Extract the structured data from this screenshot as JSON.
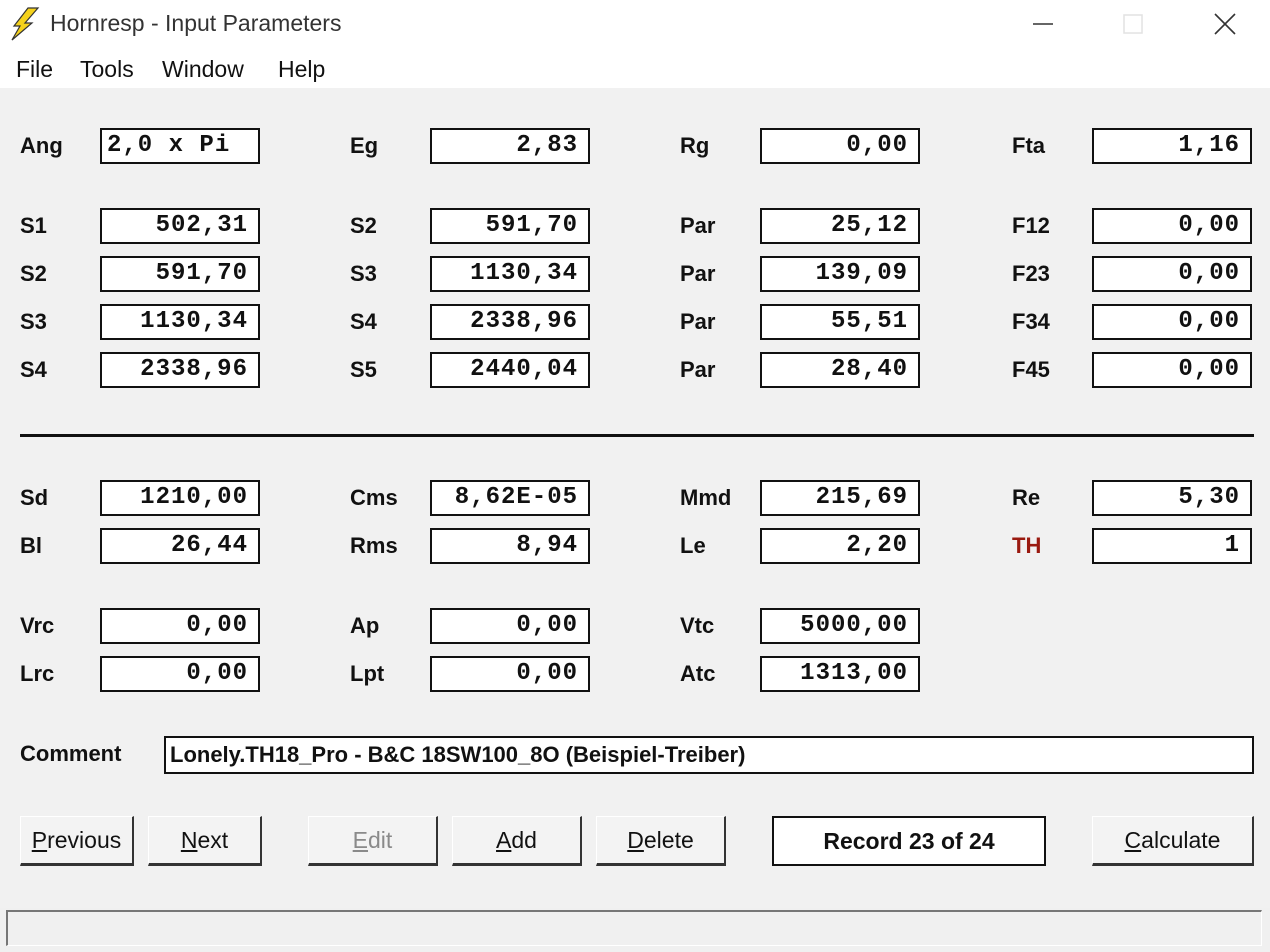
{
  "window": {
    "title": "Hornresp - Input Parameters",
    "icon": "lightning-bolt-icon"
  },
  "menu": [
    "File",
    "Tools",
    "Window",
    "Help"
  ],
  "rows": [
    [
      {
        "label": "Ang",
        "value": "2,0 x Pi",
        "align": "left"
      },
      {
        "label": "Eg",
        "value": "2,83"
      },
      {
        "label": "Rg",
        "value": "0,00"
      },
      {
        "label": "Fta",
        "value": "1,16"
      }
    ],
    [
      {
        "label": "S1",
        "value": "502,31"
      },
      {
        "label": "S2",
        "value": "591,70"
      },
      {
        "label": "Par",
        "value": "25,12"
      },
      {
        "label": "F12",
        "value": "0,00"
      }
    ],
    [
      {
        "label": "S2",
        "value": "591,70"
      },
      {
        "label": "S3",
        "value": "1130,34"
      },
      {
        "label": "Par",
        "value": "139,09"
      },
      {
        "label": "F23",
        "value": "0,00"
      }
    ],
    [
      {
        "label": "S3",
        "value": "1130,34"
      },
      {
        "label": "S4",
        "value": "2338,96"
      },
      {
        "label": "Par",
        "value": "55,51"
      },
      {
        "label": "F34",
        "value": "0,00"
      }
    ],
    [
      {
        "label": "S4",
        "value": "2338,96"
      },
      {
        "label": "S5",
        "value": "2440,04"
      },
      {
        "label": "Par",
        "value": "28,40"
      },
      {
        "label": "F45",
        "value": "0,00"
      }
    ],
    [
      {
        "label": "Sd",
        "value": "1210,00"
      },
      {
        "label": "Cms",
        "value": "8,62E-05"
      },
      {
        "label": "Mmd",
        "value": "215,69"
      },
      {
        "label": "Re",
        "value": "5,30"
      }
    ],
    [
      {
        "label": "Bl",
        "value": "26,44"
      },
      {
        "label": "Rms",
        "value": "8,94"
      },
      {
        "label": "Le",
        "value": "2,20"
      },
      {
        "label": "TH",
        "value": "1",
        "highlight": true
      }
    ],
    [
      {
        "label": "Vrc",
        "value": "0,00"
      },
      {
        "label": "Ap",
        "value": "0,00"
      },
      {
        "label": "Vtc",
        "value": "5000,00"
      }
    ],
    [
      {
        "label": "Lrc",
        "value": "0,00"
      },
      {
        "label": "Lpt",
        "value": "0,00"
      },
      {
        "label": "Atc",
        "value": "1313,00"
      }
    ]
  ],
  "comment": {
    "label": "Comment",
    "value": "Lonely.TH18_Pro - B&C 18SW100_8O (Beispiel-Treiber)"
  },
  "buttons": {
    "previous": "Previous",
    "next": "Next",
    "edit": "Edit",
    "add": "Add",
    "delete": "Delete",
    "calculate": "Calculate"
  },
  "record": "Record 23 of 24",
  "colors": {
    "highlight_label": "#9a1a10",
    "icon": "#f5d21c"
  }
}
